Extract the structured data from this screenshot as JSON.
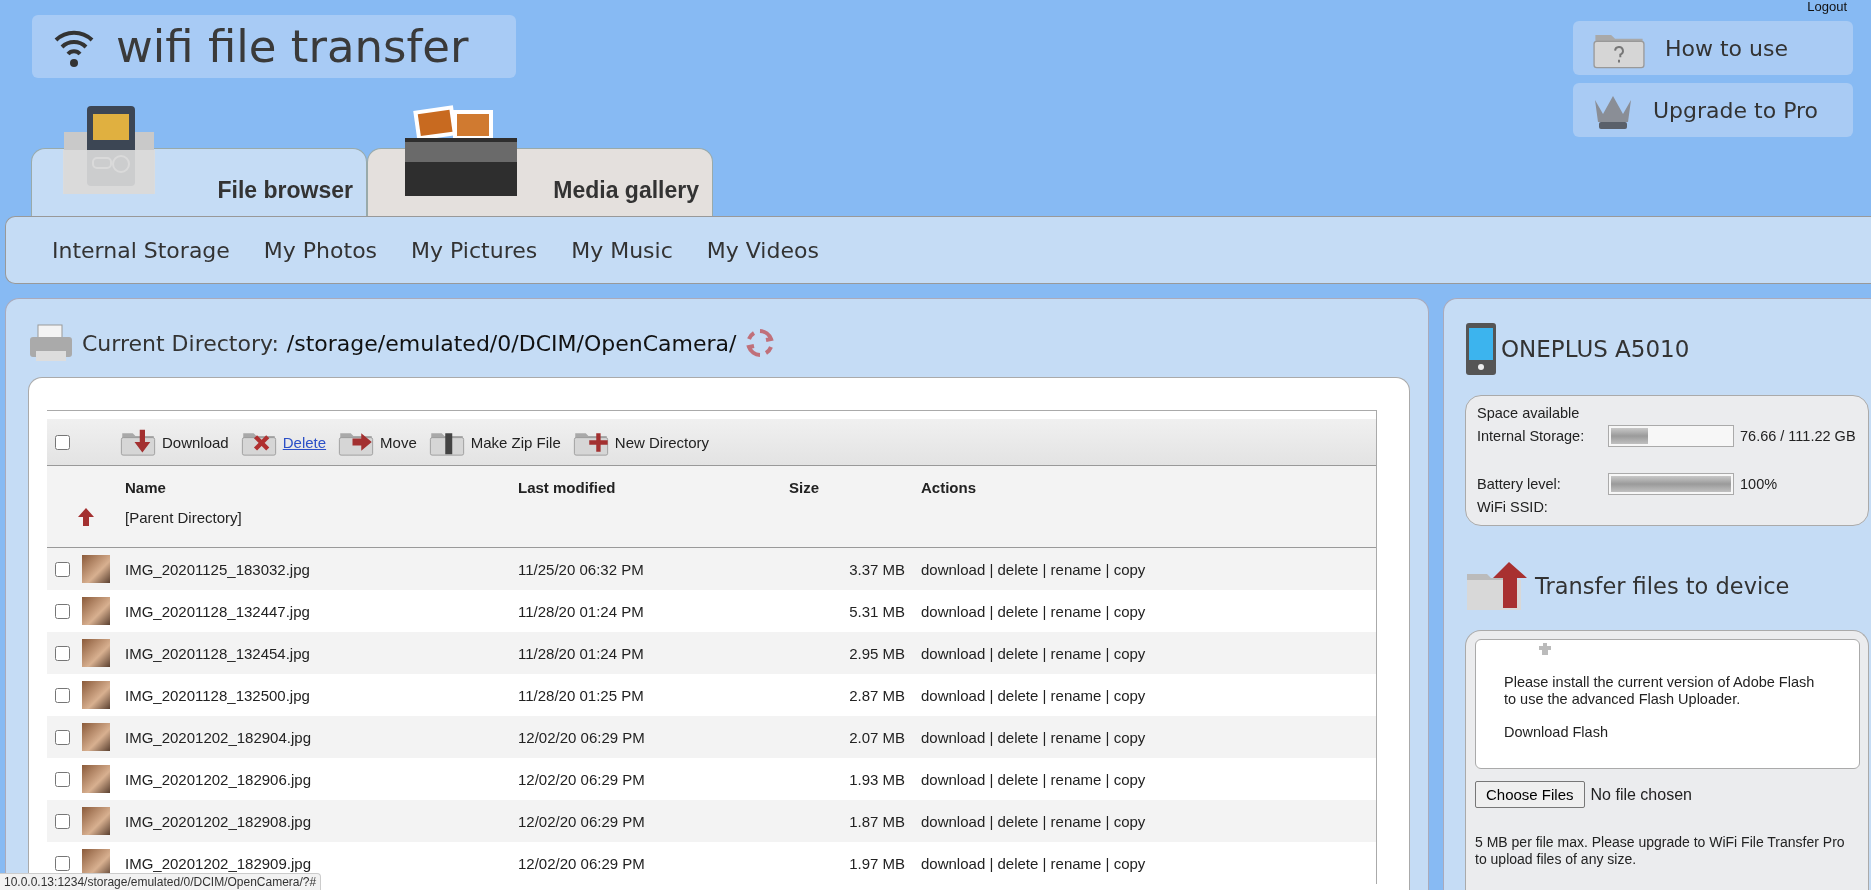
{
  "logo": {
    "title": "wifi file transfer"
  },
  "logout": "Logout",
  "top_buttons": [
    {
      "kind": "help",
      "label": "How to use"
    },
    {
      "kind": "upgrade",
      "label": "Upgrade to Pro"
    }
  ],
  "tabs": [
    {
      "kind": "card",
      "label": "File browser",
      "selected": true
    },
    {
      "kind": "media",
      "label": "Media gallery",
      "selected": false
    }
  ],
  "nav": [
    "Internal Storage",
    "My Photos",
    "My Pictures",
    "My Music",
    "My Videos"
  ],
  "directory": {
    "label": "Current Directory:",
    "path": "/storage/emulated/0/DCIM/OpenCamera/"
  },
  "toolbar": {
    "select_all": {
      "checked": false
    },
    "actions": [
      {
        "label": "Download",
        "kind": "plain"
      },
      {
        "label": "Delete",
        "kind": "link"
      },
      {
        "label": "Move",
        "kind": "plain"
      },
      {
        "label": "Make Zip File",
        "kind": "plain"
      },
      {
        "label": "New Directory",
        "kind": "plain"
      }
    ]
  },
  "table": {
    "columns": [
      "Name",
      "Last modified",
      "Size",
      "Actions"
    ],
    "parent": "[Parent Directory]",
    "rows": [
      {
        "name": "IMG_20201125_183032.jpg",
        "modified": "11/25/20 06:32 PM",
        "size": "3.37 MB",
        "actions": "download | delete | rename | copy",
        "checked": false
      },
      {
        "name": "IMG_20201128_132447.jpg",
        "modified": "11/28/20 01:24 PM",
        "size": "5.31 MB",
        "actions": "download | delete | rename | copy",
        "checked": false
      },
      {
        "name": "IMG_20201128_132454.jpg",
        "modified": "11/28/20 01:24 PM",
        "size": "2.95 MB",
        "actions": "download | delete | rename | copy",
        "checked": false
      },
      {
        "name": "IMG_20201128_132500.jpg",
        "modified": "11/28/20 01:25 PM",
        "size": "2.87 MB",
        "actions": "download | delete | rename | copy",
        "checked": false
      },
      {
        "name": "IMG_20201202_182904.jpg",
        "modified": "12/02/20 06:29 PM",
        "size": "2.07 MB",
        "actions": "download | delete | rename | copy",
        "checked": false
      },
      {
        "name": "IMG_20201202_182906.jpg",
        "modified": "12/02/20 06:29 PM",
        "size": "1.93 MB",
        "actions": "download | delete | rename | copy",
        "checked": false
      },
      {
        "name": "IMG_20201202_182908.jpg",
        "modified": "12/02/20 06:29 PM",
        "size": "1.87 MB",
        "actions": "download | delete | rename | copy",
        "checked": false
      },
      {
        "name": "IMG_20201202_182909.jpg",
        "modified": "12/02/20 06:29 PM",
        "size": "1.97 MB",
        "actions": "download | delete | rename | copy",
        "checked": false
      }
    ]
  },
  "device": {
    "name": "ONEPLUS A5010",
    "space_title": "Space available",
    "storage": {
      "label": "Internal Storage:",
      "level": 0.31,
      "reading": "76.66 / 111.22 GB"
    },
    "battery": {
      "label": "Battery level:",
      "level": 1,
      "reading": "100%"
    },
    "ssid": {
      "label": "WiFi SSID:"
    }
  },
  "transfer": {
    "title": "Transfer files to device",
    "flash_message": "Please install the current version of Adobe Flash to use the advanced Flash Uploader.",
    "flash_link": "Download Flash",
    "choose_button": "Choose Files",
    "file_status": "No file chosen",
    "note": "5 MB per file max. Please upgrade to WiFi File Transfer Pro to upload files of any size."
  },
  "status_url": "10.0.0.13:1234/storage/emulated/0/DCIM/OpenCamera/?#"
}
